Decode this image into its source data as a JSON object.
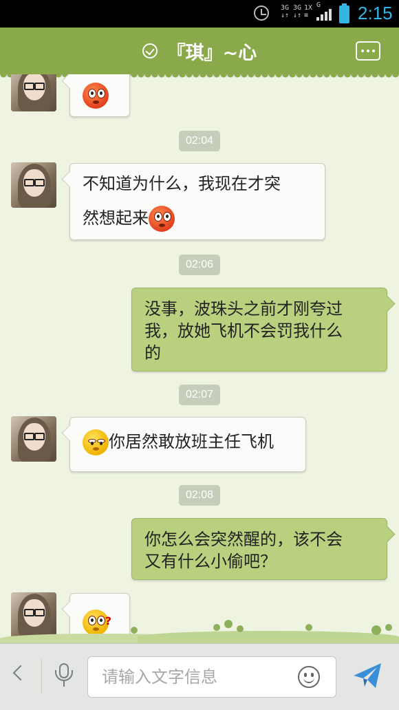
{
  "status_bar": {
    "network_labels": [
      "3G",
      "3G",
      "1X",
      "G"
    ],
    "time": "2:15",
    "accent_color": "#33b5e5"
  },
  "header": {
    "title": "『琪』~心",
    "status_icon": "check-circle-icon",
    "menu_icon": "more-options-icon",
    "color": "#8aa94a"
  },
  "messages": [
    {
      "type": "incoming",
      "text": "",
      "emoji": "surprised-emoji"
    },
    {
      "type": "time",
      "text": "02:04"
    },
    {
      "type": "incoming",
      "lines": [
        "不知道为什么，我现在才突",
        "然想起来"
      ],
      "emoji": "surprised-emoji"
    },
    {
      "type": "time",
      "text": "02:06"
    },
    {
      "type": "outgoing",
      "lines": [
        "没事，波珠头之前才刚夸过",
        "我，放她飞机不会罚我什么",
        "的"
      ]
    },
    {
      "type": "time",
      "text": "02:07"
    },
    {
      "type": "incoming",
      "text": "你居然敢放班主任飞机",
      "emoji": "shy-emoji"
    },
    {
      "type": "time",
      "text": "02:08"
    },
    {
      "type": "outgoing",
      "lines": [
        "你怎么会突然醒的，该不会",
        "又有什么小偷吧？"
      ]
    },
    {
      "type": "incoming",
      "text": "",
      "emoji": "confused-emoji"
    }
  ],
  "input_bar": {
    "placeholder": "请输入文字信息",
    "back_icon": "chevron-left-icon",
    "voice_icon": "microphone-icon",
    "emoji_icon": "smiley-icon",
    "send_icon": "send-icon",
    "send_color": "#3a8fd8"
  }
}
